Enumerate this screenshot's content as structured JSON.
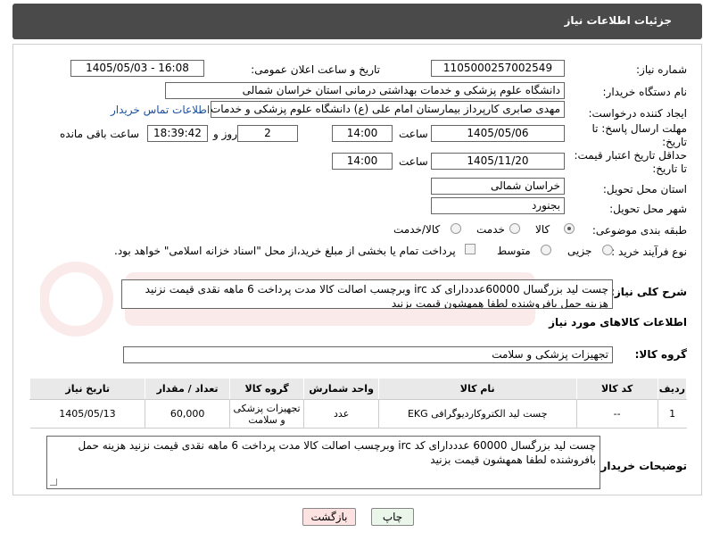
{
  "header": {
    "title": "جزئیات اطلاعات نیاز"
  },
  "fields": {
    "need_number_label": "شماره نیاز:",
    "need_number": "1105000257002549",
    "announce_label": "تاریخ و ساعت اعلان عمومی:",
    "announce_value": "1405/05/03 - 16:08",
    "buyer_org_label": "نام دستگاه خریدار:",
    "buyer_org": "دانشگاه علوم پزشکی و خدمات بهداشتی درمانی استان خراسان شمالی",
    "creator_label": "ایجاد کننده درخواست:",
    "creator": "مهدی صابری کارپرداز بیمارستان امام علی (ع) دانشگاه علوم پزشکی و خدمات بهداشتی",
    "contact_link": "اطلاعات تماس خریدار",
    "reply_deadline_label_1": "مهلت ارسال پاسخ: تا",
    "reply_deadline_label_2": "تاریخ:",
    "reply_date": "1405/05/06",
    "time_label": "ساعت",
    "reply_time": "14:00",
    "day_label": "روز و",
    "reply_days": "2",
    "remaining_time": "18:39:42",
    "remaining_label": "ساعت باقی مانده",
    "price_deadline_label_1": "حداقل تاریخ اعتبار قیمت:",
    "price_deadline_label_2": "تا تاریخ:",
    "price_date": "1405/11/20",
    "price_time": "14:00",
    "delivery_province_label": "استان محل تحویل:",
    "delivery_province": "خراسان شمالی",
    "delivery_city_label": "شهر محل تحویل:",
    "delivery_city": "بجنورد",
    "category_label": "طبقه بندی موضوعی:",
    "category_options": [
      "کالا",
      "خدمت",
      "کالا/خدمت"
    ],
    "process_label": "نوع فرآیند خرید :",
    "process_options": [
      "جزیی",
      "متوسط"
    ],
    "payment_note": "پرداخت تمام یا بخشی از مبلغ خرید،از محل \"اسناد خزانه اسلامی\" خواهد بود."
  },
  "description": {
    "label": "شرح کلی نیاز:",
    "text": "چست لید بزرگسال 60000عدددارای کد irc وبرچسب اصالت کالا مدت پرداخت 6 ماهه نقدی قیمت نزنید هزینه حمل بافروشنده لطفا همهشون قیمت بزنید"
  },
  "goods": {
    "section_title": "اطلاعات کالاهای مورد نیاز",
    "group_label": "گروه کالا:",
    "group_value": "تجهیزات پزشکی و سلامت",
    "columns": [
      "ردیف",
      "کد کالا",
      "نام کالا",
      "واحد شمارش",
      "گروه کالا",
      "تعداد / مقدار",
      "تاریخ نیاز"
    ],
    "rows": [
      [
        "1",
        "--",
        "چست لید الکتروکاردیوگرافی EKG",
        "عدد",
        "تجهیزات پزشکی و سلامت",
        "60,000",
        "1405/05/13"
      ]
    ]
  },
  "buyer_notes": {
    "label": "توضیحات خریدار:",
    "text": "چست لید بزرگسال 60000 عدددارای کد irc وبرچسب اصالت کالا مدت پرداخت 6 ماهه نقدی قیمت نزنید هزینه حمل بافروشنده لطفا همهشون قیمت بزنید"
  },
  "buttons": {
    "print": "چاپ",
    "back": "بازگشت"
  },
  "colors": {
    "header_bg": "#4a4a4a",
    "link": "#1a4f9c",
    "back_bg": "#fde2e2",
    "print_bg": "#eaf6ea"
  }
}
